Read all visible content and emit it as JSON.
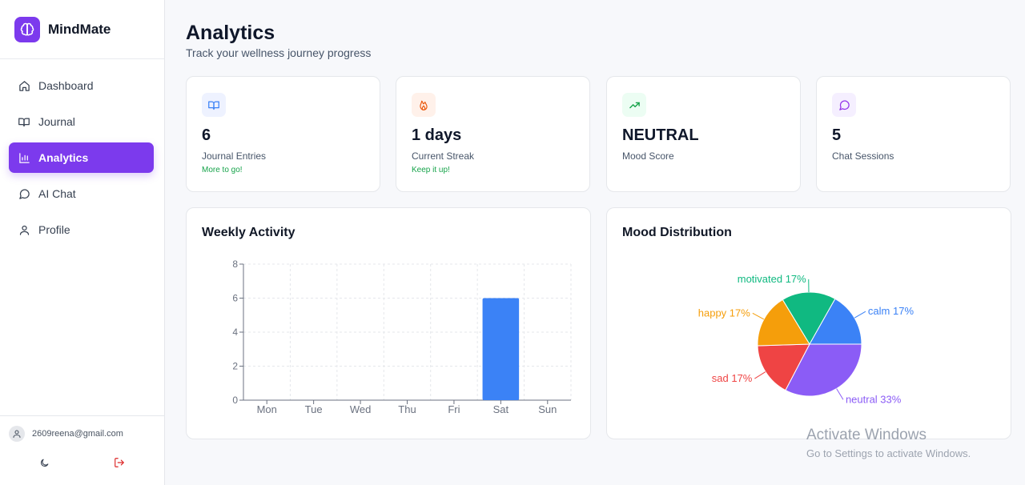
{
  "app": {
    "name": "MindMate"
  },
  "sidebar": {
    "items": [
      {
        "label": "Dashboard",
        "icon": "home-icon"
      },
      {
        "label": "Journal",
        "icon": "book-icon"
      },
      {
        "label": "Analytics",
        "icon": "bar-chart-icon",
        "active": true
      },
      {
        "label": "AI Chat",
        "icon": "chat-icon"
      },
      {
        "label": "Profile",
        "icon": "user-icon"
      }
    ],
    "user_email": "2609reena@gmail.com"
  },
  "header": {
    "title": "Analytics",
    "subtitle": "Track your wellness journey progress"
  },
  "stats": [
    {
      "value": "6",
      "label": "Journal Entries",
      "note": "More to go!",
      "icon": "book-icon",
      "icon_color": "#3b82f6",
      "icon_bg": "#eef2ff"
    },
    {
      "value": "1 days",
      "label": "Current Streak",
      "note": "Keep it up!",
      "icon": "flame-icon",
      "icon_color": "#ea580c",
      "icon_bg": "#fff1ea"
    },
    {
      "value": "NEUTRAL",
      "label": "Mood Score",
      "note": "",
      "icon": "trending-up-icon",
      "icon_color": "#16a34a",
      "icon_bg": "#ecfdf3"
    },
    {
      "value": "5",
      "label": "Chat Sessions",
      "note": "",
      "icon": "chat-icon",
      "icon_color": "#9333ea",
      "icon_bg": "#f5efff"
    }
  ],
  "weekly_panel": {
    "title": "Weekly Activity"
  },
  "mood_panel": {
    "title": "Mood Distribution"
  },
  "chart_data": [
    {
      "type": "bar",
      "title": "Weekly Activity",
      "categories": [
        "Mon",
        "Tue",
        "Wed",
        "Thu",
        "Fri",
        "Sat",
        "Sun"
      ],
      "values": [
        0,
        0,
        0,
        0,
        0,
        6,
        0
      ],
      "ylim": [
        0,
        8
      ],
      "yticks": [
        0,
        2,
        4,
        6,
        8
      ],
      "grid": true,
      "color": "#3b82f6"
    },
    {
      "type": "pie",
      "title": "Mood Distribution",
      "slices": [
        {
          "name": "calm",
          "value": 17,
          "label": "calm 17%",
          "color": "#3b82f6"
        },
        {
          "name": "neutral",
          "value": 33,
          "label": "neutral 33%",
          "color": "#8b5cf6"
        },
        {
          "name": "sad",
          "value": 17,
          "label": "sad 17%",
          "color": "#ef4444"
        },
        {
          "name": "happy",
          "value": 17,
          "label": "happy 17%",
          "color": "#f59e0b"
        },
        {
          "name": "motivated",
          "value": 17,
          "label": "motivated 17%",
          "color": "#10b981"
        }
      ]
    }
  ],
  "watermark": {
    "line1": "Activate Windows",
    "line2": "Go to Settings to activate Windows."
  }
}
